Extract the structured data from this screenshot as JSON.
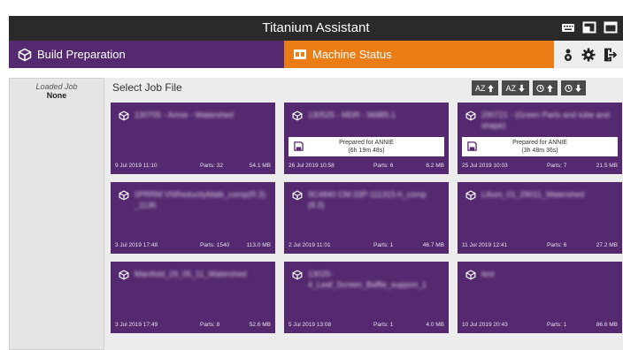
{
  "app": {
    "title": "Titanium Assistant",
    "window_icons": [
      "keyboard-icon",
      "restore-window-icon",
      "maximize-window-icon"
    ]
  },
  "nav": {
    "build_label": "Build Preparation",
    "machine_label": "Machine Status",
    "right_icons": [
      "operator-icon",
      "settings-gear-icon",
      "logout-icon"
    ]
  },
  "sidebar": {
    "loaded_job_label": "Loaded Job",
    "loaded_job_value": "None"
  },
  "main": {
    "title": "Select Job File",
    "sort_buttons": [
      {
        "label": "AZ",
        "icon": "arrow-up-icon"
      },
      {
        "label": "AZ",
        "icon": "arrow-down-icon"
      },
      {
        "label": "",
        "icon": "clock-arrow-up-icon"
      },
      {
        "label": "",
        "icon": "clock-arrow-down-icon"
      }
    ]
  },
  "jobs": [
    {
      "name": "130705 - Annie - Watershed",
      "date": "9 Jul 2019 11:10",
      "parts": "Parts: 32",
      "size": "54.1 MB",
      "prepared": null
    },
    {
      "name": "130525 - MDR - 96885.1",
      "date": "26 Jul 2019 10:58",
      "parts": "Parts: 6",
      "size": "8.2 MB",
      "prepared": {
        "line1": "Prepared for ANNIE",
        "line2": "(6h 19m 48s)"
      }
    },
    {
      "name": "290721 - (Green Parts and tube and shape)",
      "date": "25 Jul 2019 10:03",
      "parts": "Parts: 7",
      "size": "21.5 MB",
      "prepared": {
        "line1": "Prepared for ANNIE",
        "line2": "(3h 48m 36s)"
      }
    },
    {
      "name": "0PRRM VNReductlyMatk_comp(R.3) _1136",
      "date": "3 Jul 2019 17:48",
      "parts": "Parts: 1540",
      "size": "113.0 MB",
      "prepared": null
    },
    {
      "name": "9C4840 CM-33P-111315-h_comp (8.3)",
      "date": "2 Jul 2019 11:01",
      "parts": "Parts: 1",
      "size": "46.7 MB",
      "prepared": null
    },
    {
      "name": "Lilium_01_29011_Watershed",
      "date": "11 Jul 2019 12:41",
      "parts": "Parts: 6",
      "size": "27.2 MB",
      "prepared": null
    },
    {
      "name": "Manifold_29_05_11_Watershed",
      "date": "3 Jul 2019 17:49",
      "parts": "Parts: 8",
      "size": "52.6 MB",
      "prepared": null
    },
    {
      "name": "13025-4_Leaf_Screen_Baffle_support_1",
      "date": "5 Jul 2019 13:08",
      "parts": "Parts: 1",
      "size": "4.0 MB",
      "prepared": null
    },
    {
      "name": "test",
      "date": "10 Jul 2019 20:43",
      "parts": "Parts: 1",
      "size": "86.6 MB",
      "prepared": null
    }
  ],
  "colors": {
    "card_purple": "#55296f",
    "machine_orange": "#ea7d16",
    "titlebar": "#2a2a2a"
  }
}
